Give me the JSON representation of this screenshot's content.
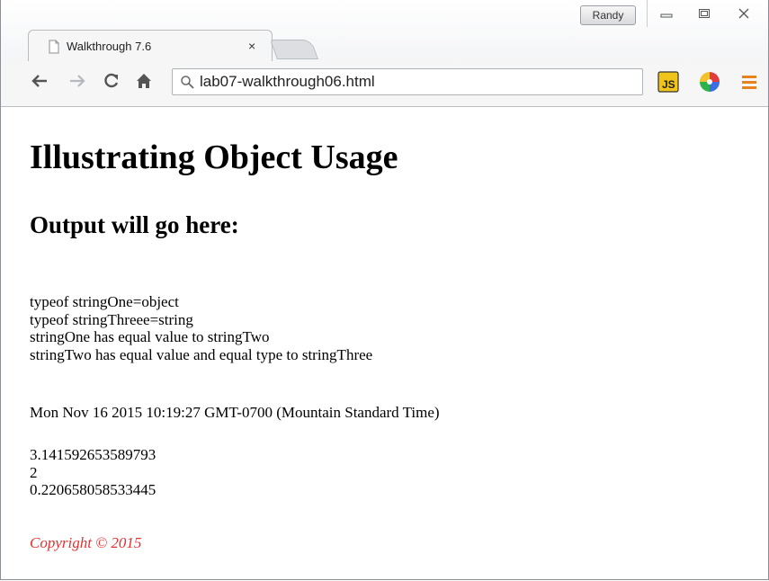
{
  "browser": {
    "profile_label": "Randy",
    "tab": {
      "title": "Walkthrough 7.6",
      "close_glyph": "×"
    },
    "omnibox": {
      "url": "lab07-walkthrough06.html"
    },
    "icons": {
      "back": "back-arrow-icon",
      "forward": "forward-arrow-icon",
      "reload": "reload-icon",
      "home": "home-icon",
      "search": "search-icon",
      "js_extension": "js-extension-icon",
      "color_extension": "color-wheel-icon",
      "menu": "hamburger-menu-icon"
    },
    "colors": {
      "menu_accent": "#e8821e",
      "js_badge": "#f0c419"
    }
  },
  "page": {
    "heading": "Illustrating Object Usage",
    "subheading": "Output will go here:",
    "output_lines": [
      "typeof stringOne=object",
      "typeof stringThreee=string",
      "stringOne has equal value to stringTwo",
      "stringTwo has equal value and equal type to stringThree"
    ],
    "date_line": "Mon Nov 16 2015 10:19:27 GMT-0700 (Mountain Standard Time)",
    "math_lines": [
      "3.141592653589793",
      "2",
      "0.220658058533445"
    ],
    "copyright": "Copyright © 2015",
    "colors": {
      "copyright": "#e53030"
    }
  }
}
